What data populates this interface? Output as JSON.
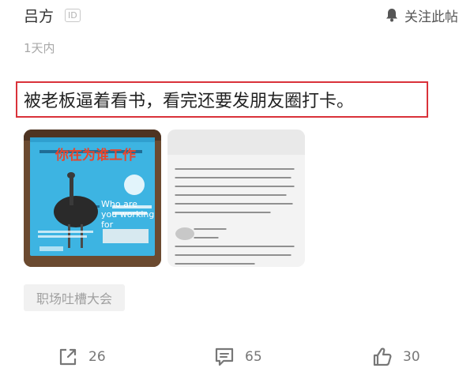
{
  "post": {
    "author": "吕方",
    "id_badge": "ID",
    "follow_label": "关注此帖",
    "time": "1天内",
    "text": "被老板逼着看书，看完还要发朋友圈打卡。",
    "images": [
      {
        "title": "你在为谁工作",
        "subtitle": "Who are you working for"
      },
      {
        "kind": "handwritten-note"
      }
    ],
    "tag": "职场吐槽大会"
  },
  "actions": {
    "share_count": "26",
    "comment_count": "65",
    "like_count": "30"
  },
  "colors": {
    "highlight_border": "#d9323a",
    "book_cover_blue": "#3db4e2",
    "book_title_red": "#e8452c",
    "muted_text": "#a8a8a8"
  },
  "icons": {
    "follow": "bell-icon",
    "share": "share-icon",
    "comment": "comment-icon",
    "like": "thumbs-up-icon"
  }
}
